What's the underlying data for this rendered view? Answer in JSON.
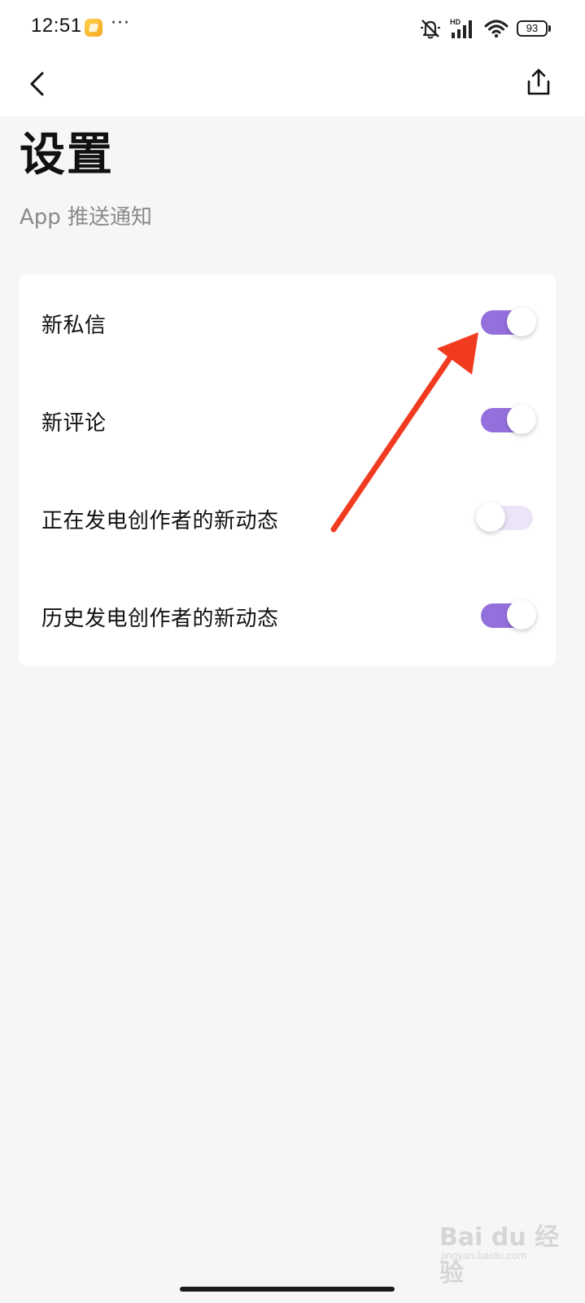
{
  "status_bar": {
    "time": "12:51",
    "more": "···",
    "battery": "93",
    "signal_label": "HD",
    "icons": [
      "notification-app-icon",
      "mute-icon",
      "signal-icon",
      "wifi-icon",
      "battery-icon"
    ]
  },
  "nav": {
    "back_icon": "chevron-left-icon",
    "share_icon": "share-icon"
  },
  "page": {
    "title": "设置",
    "section": "App 推送通知"
  },
  "settings": [
    {
      "label": "新私信",
      "enabled": true
    },
    {
      "label": "新评论",
      "enabled": true
    },
    {
      "label": "正在发电创作者的新动态",
      "enabled": false
    },
    {
      "label": "历史发电创作者的新动态",
      "enabled": true
    }
  ],
  "colors": {
    "toggle_on": "#9470dd",
    "toggle_off": "#ebe5f7",
    "arrow": "#f03b20",
    "background": "#f6f6f6"
  },
  "watermark": {
    "text": "Bai du 经验",
    "sub": "jingyan.baidu.com"
  }
}
